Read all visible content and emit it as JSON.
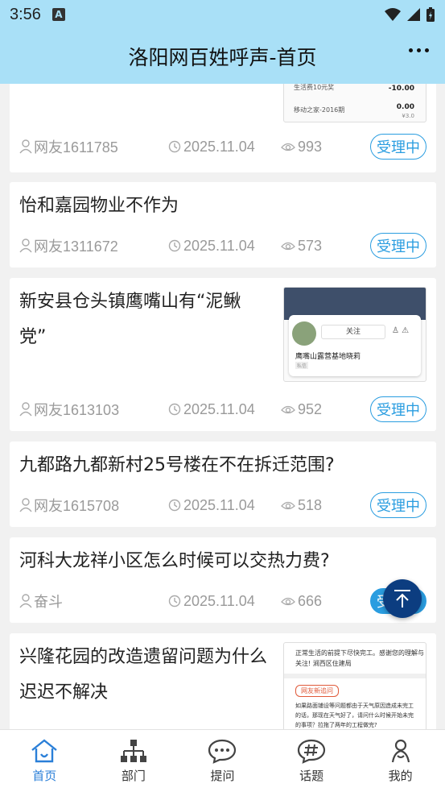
{
  "status": {
    "time": "3:56",
    "notif_letter": "A"
  },
  "header": {
    "title": "洛阳网百姓呼声-首页"
  },
  "cards": [
    {
      "title": "",
      "user": "网友1611785",
      "date": "2025.11.04",
      "views": "993",
      "status": "受理中",
      "thumb": {
        "row1_label": "生活费10元奖",
        "row1_value": "-10.00",
        "row2_label": "移动之家-2016期",
        "row2_value": "0.00",
        "row2_sub": "¥3.0"
      }
    },
    {
      "title": "怡和嘉园物业不作为",
      "user": "网友1311672",
      "date": "2025.11.04",
      "views": "573",
      "status": "受理中"
    },
    {
      "title": "新安县仓头镇鹰嘴山有“泥鳅党”",
      "title_line1": "新安县仓头镇鹰嘴山有“泥鳅",
      "title_line2": "党”",
      "user": "网友1613103",
      "date": "2025.11.04",
      "views": "952",
      "status": "受理中",
      "thumb": {
        "follow": "关注",
        "name": "鹰嘴山露营基地晓莉",
        "tag": "私信"
      }
    },
    {
      "title": "九都路九都新村25号楼在不在拆迁范围?",
      "user": "网友1615708",
      "date": "2025.11.04",
      "views": "518",
      "status": "受理中"
    },
    {
      "title": "河科大龙祥小区怎么时候可以交热力费?",
      "user": "奋斗",
      "date": "2025.11.04",
      "views": "666",
      "status": "受理中"
    },
    {
      "title": "兴隆花园的改造遗留问题为什么迟迟不解决",
      "title_line1": "兴隆花园的改造遗留问题为什么",
      "title_line2": "迟迟不解决",
      "thumb": {
        "line1": "正常生活的前提下尽快完工。感谢您的理解与",
        "line2": "关注!  涧西区住建局",
        "label": "网友新追问",
        "q1": "如果路面铺设等问题都由于天气原因造成未完工",
        "q2": "的话，那现在天气好了，请问什么时候开始未完",
        "q3": "的事项？拉拖了两年的工程做完?"
      }
    }
  ],
  "tabs": [
    {
      "label": "首页",
      "active": true
    },
    {
      "label": "部门",
      "active": false
    },
    {
      "label": "提问",
      "active": false
    },
    {
      "label": "话题",
      "active": false
    },
    {
      "label": "我的",
      "active": false
    }
  ],
  "colors": {
    "header_bg": "#a9e0f7",
    "accent": "#2a9de0",
    "tab_active": "#2a7fd8"
  }
}
